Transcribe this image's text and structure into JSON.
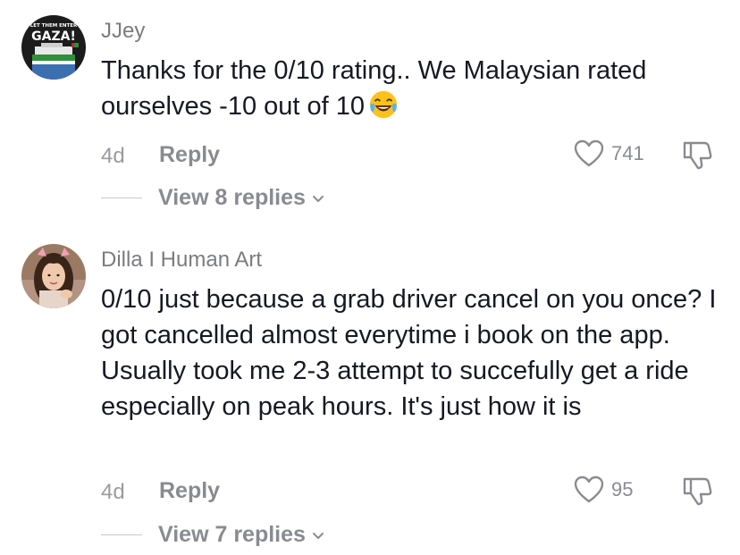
{
  "comments": [
    {
      "username": "JJey",
      "avatar": {
        "text_top": "LET THEM ENTER",
        "text_main": "GAZA!"
      },
      "text": "Thanks for the 0/10 rating.. We Malaysian rated ourselves -10 out of 10",
      "emoji": "laughing-tears-emoji",
      "age": "4d",
      "reply_label": "Reply",
      "likes": "741",
      "view_replies": "View 8 replies"
    },
    {
      "username": "Dilla I Human Art",
      "text": "0/10 just because a grab driver cancel on you once? I got cancelled almost everytime i book on the app. Usually took me 2-3 attempt to succefully get a ride especially on peak hours. It's just how it is",
      "age": "4d",
      "reply_label": "Reply",
      "likes": "95",
      "view_replies": "View 7 replies"
    }
  ],
  "icons": {
    "like": "heart-outline-icon",
    "dislike": "thumbs-down-outline-icon",
    "expand": "chevron-down-icon"
  },
  "colors": {
    "text_primary": "#161823",
    "text_secondary": "#8a8b91",
    "avatar_bg": "#1c1c1c",
    "emoji_yellow": "#fcc21b"
  }
}
